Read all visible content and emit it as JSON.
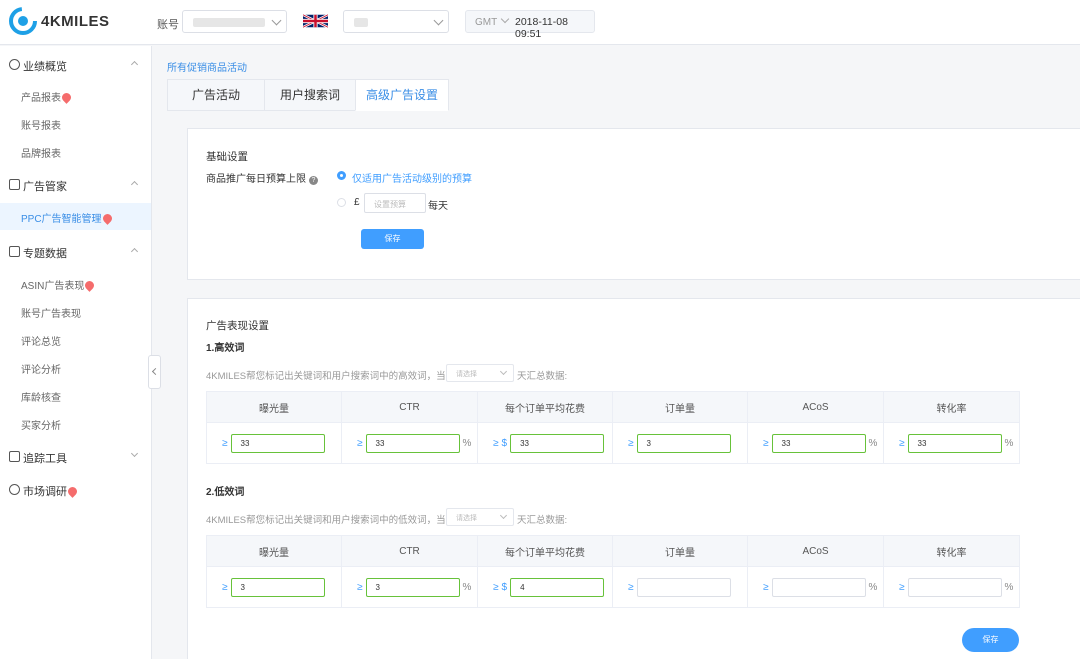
{
  "brand": {
    "name": "4KMILES",
    "accent": "#409eff"
  },
  "header": {
    "account_label": "账号",
    "timezone_label": "GMT",
    "datetime": "2018-11-08 09:51",
    "flag_icon": "uk-flag-icon"
  },
  "sidebar": {
    "groups": {
      "g1": {
        "label": "业绩概览",
        "icon": "dashboard-icon"
      },
      "g2": {
        "label": "广告管家",
        "icon": "ad-icon"
      },
      "g3": {
        "label": "专题数据",
        "icon": "data-icon"
      },
      "g4": {
        "label": "追踪工具",
        "icon": "tracking-icon"
      },
      "g5": {
        "label": "市场调研",
        "icon": "research-icon"
      }
    },
    "items": {
      "product_report": "产品报表",
      "account_report": "账号报表",
      "brand_report": "品牌报表",
      "ppc": "PPC广告智能管理",
      "asin_ads": "ASIN广告表现",
      "account_ads": "账号广告表现",
      "review_overview": "评论总览",
      "review_analysis": "评论分析",
      "inventory_age": "库龄核查",
      "buyer_analysis": "买家分析"
    }
  },
  "breadcrumb": "所有促销商品活动",
  "tabs": [
    "广告活动",
    "用户搜索词",
    "高级广告设置"
  ],
  "basic": {
    "title": "基础设置",
    "budget_label": "商品推广每日预算上限",
    "option1": "仅适用广告活动级别的预算",
    "currency": "£",
    "budget_placeholder": "设置预算",
    "per_day": "每天",
    "save": "保存"
  },
  "performance": {
    "title": "广告表现设置",
    "high": {
      "title": "1.高效词",
      "hint_pre": "4KMILES帮您标记出关键词和用户搜索词中的高效词，当过去",
      "hint_post": "天汇总数据:",
      "select_placeholder": "请选择"
    },
    "low": {
      "title": "2.低效词",
      "hint_pre": "4KMILES帮您标记出关键词和用户搜索词中的低效词，当过去",
      "hint_post": "天汇总数据:",
      "select_placeholder": "请选择"
    },
    "columns": [
      "曝光量",
      "CTR",
      "每个订单平均花费",
      "订单量",
      "ACoS",
      "转化率"
    ],
    "ge": "≥",
    "dollar": "$",
    "pct": "%",
    "high_values": [
      "33",
      "33",
      "33",
      "3",
      "33",
      "33"
    ],
    "low_values": [
      "3",
      "3",
      "4",
      "",
      "",
      ""
    ],
    "save": "保存"
  }
}
